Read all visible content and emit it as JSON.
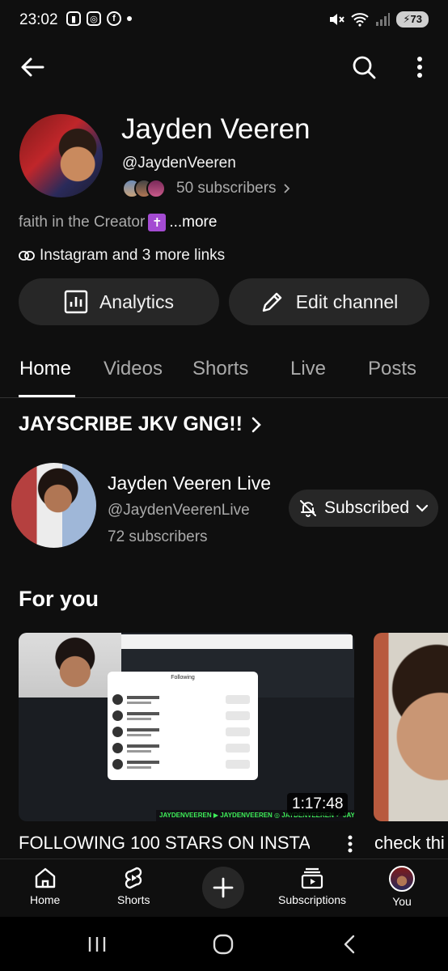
{
  "status_bar": {
    "time": "23:02",
    "battery": "73",
    "signal_label": "5"
  },
  "profile": {
    "name": "Jayden Veeren",
    "handle": "@JaydenVeeren",
    "subscribers": "50 subscribers",
    "description": "faith in the Creator",
    "description_emoji": "✝",
    "more_label": "...more",
    "links_text": "Instagram and 3 more links"
  },
  "actions": {
    "analytics_label": "Analytics",
    "edit_label": "Edit channel"
  },
  "tabs": [
    {
      "label": "Home"
    },
    {
      "label": "Videos"
    },
    {
      "label": "Shorts"
    },
    {
      "label": "Live"
    },
    {
      "label": "Posts"
    }
  ],
  "section": {
    "title": "JAYSCRIBE JKV GNG!!"
  },
  "featured_channel": {
    "name": "Jayden Veeren Live",
    "handle": "@JaydenVeerenLive",
    "subscribers": "72 subscribers",
    "subscribe_label": "Subscribed"
  },
  "for_you": {
    "heading": "For you",
    "videos": [
      {
        "title": "FOLLOWING 100 STARS ON INSTA",
        "duration": "1:17:48",
        "thumb_modal_title": "Following",
        "thumb_banner": "JAYDENVEEREN ▶ JAYDENVEEREN ◎ JAYDENVEEREN ✓ JAYDENVEEREN"
      },
      {
        "title": "check thi"
      }
    ]
  },
  "bottom_nav": {
    "home": "Home",
    "shorts": "Shorts",
    "subscriptions": "Subscriptions",
    "you": "You"
  },
  "colors": {
    "background": "#0f0f0f",
    "surface": "#272727",
    "secondary_text": "#aaaaaa",
    "emoji_purple": "#a44bd2"
  }
}
